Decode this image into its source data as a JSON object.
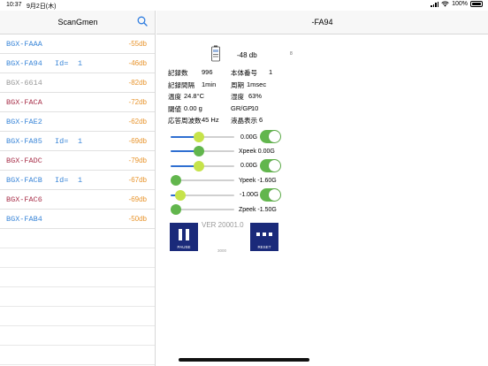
{
  "status": {
    "time": "10:37",
    "date": "9月2日(木)",
    "battery": "100%"
  },
  "sidebar": {
    "title": "ScanGmen",
    "search_icon": "search-icon",
    "items": [
      {
        "name": "BGX-FAAA",
        "id_label": "",
        "id_value": "",
        "rssi": "-55db",
        "name_color": "#3a86d8"
      },
      {
        "name": "BGX-FA94",
        "id_label": "Id=",
        "id_value": "1",
        "rssi": "-46db",
        "name_color": "#3a86d8"
      },
      {
        "name": "BGX-6614",
        "id_label": "",
        "id_value": "",
        "rssi": "-82db",
        "name_color": "#9a9a9a"
      },
      {
        "name": "BGX-FACA",
        "id_label": "",
        "id_value": "",
        "rssi": "-72db",
        "name_color": "#a8304a"
      },
      {
        "name": "BGX-FAE2",
        "id_label": "",
        "id_value": "",
        "rssi": "-62db",
        "name_color": "#3a86d8"
      },
      {
        "name": "BGX-FA85",
        "id_label": "Id=",
        "id_value": "1",
        "rssi": "-69db",
        "name_color": "#3a86d8"
      },
      {
        "name": "BGX-FADC",
        "id_label": "",
        "id_value": "",
        "rssi": "-79db",
        "name_color": "#a8304a"
      },
      {
        "name": "BGX-FACB",
        "id_label": "Id=",
        "id_value": "1",
        "rssi": "-67db",
        "name_color": "#3a86d8"
      },
      {
        "name": "BGX-FAC6",
        "id_label": "",
        "id_value": "",
        "rssi": "-69db",
        "name_color": "#a8304a"
      },
      {
        "name": "BGX-FAB4",
        "id_label": "",
        "id_value": "",
        "rssi": "-50db",
        "name_color": "#3a86d8"
      }
    ],
    "rssi_color": "#e8952e"
  },
  "detail": {
    "title": "-FA94",
    "level": "-48 db",
    "small_mark": "8",
    "info": {
      "record_count_label": "記録数",
      "record_count_value": "996",
      "body_number_label": "本体番号",
      "body_number_value": "1",
      "record_interval_label": "記録間隔",
      "record_interval_value": "1min",
      "period_label": "周期",
      "period_value": "1msec",
      "temperature_label": "温度",
      "temperature_value": "24.8°C",
      "humidity_label": "湿度",
      "humidity_value": "63%",
      "threshold_label": "閾値",
      "threshold_value": "0.00 g",
      "grgp_label": "GR/GP",
      "grgp_value": "10",
      "response_freq_label": "応答周波数",
      "response_freq_value": "45 Hz",
      "lcd_label": "液晶表示",
      "lcd_value": "6"
    },
    "controls": {
      "x_gain": "0.00G",
      "x_peek": "Xpeek 0.00G",
      "y_gain": "0.00G",
      "y_peek": "Ypeek -1.60G",
      "z_gain": "-1.00G",
      "z_peek": "Zpeek -1.50G"
    },
    "sliders": [
      {
        "name": "x-gain",
        "fraction": 0.45,
        "thumb": "#c6e34a",
        "fill": true
      },
      {
        "name": "x-peek",
        "fraction": 0.45,
        "thumb": "#62b64d",
        "fill": true
      },
      {
        "name": "y-gain",
        "fraction": 0.45,
        "thumb": "#c6e34a",
        "fill": true
      },
      {
        "name": "y-peek",
        "fraction": 0.0,
        "thumb": "#62b64d",
        "fill": false
      },
      {
        "name": "z-gain",
        "fraction": 0.15,
        "thumb": "#c6e34a",
        "fill": true
      },
      {
        "name": "z-peek",
        "fraction": 0.0,
        "thumb": "#62b64d",
        "fill": false
      }
    ],
    "toggles": [
      {
        "name": "x-toggle",
        "on": true
      },
      {
        "name": "y-toggle",
        "on": true
      },
      {
        "name": "z-toggle",
        "on": true
      }
    ],
    "pause_label": "PAUSE",
    "reset_label": "RESET",
    "version": "VER 20001.0",
    "tiny_number": "3000",
    "accent": "#1a2a7a",
    "toggle_color": "#62b64d"
  }
}
